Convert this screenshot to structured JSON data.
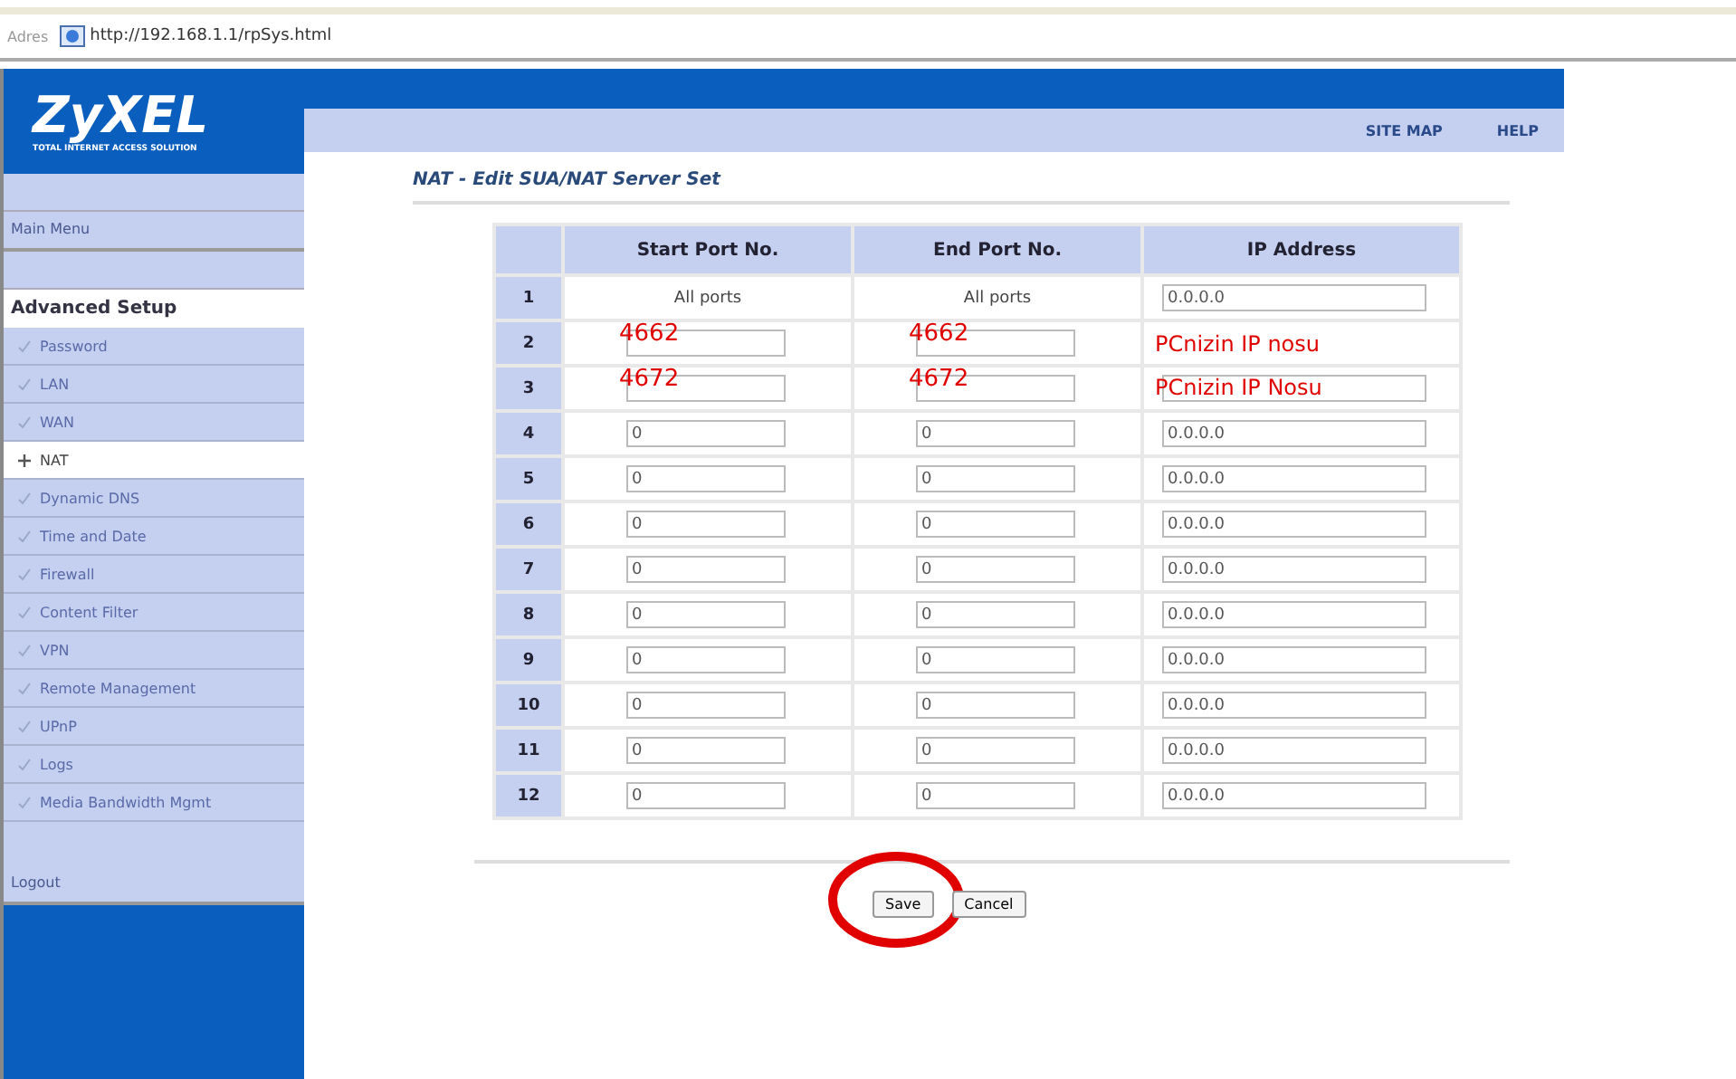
{
  "browser": {
    "address_label": "Adres",
    "url": "http://192.168.1.1/rpSys.html"
  },
  "logo": {
    "name": "ZyXEL",
    "tagline": "TOTAL INTERNET ACCESS SOLUTION"
  },
  "top_links": [
    "SITE MAP",
    "HELP"
  ],
  "sidebar": {
    "main_menu": "Main Menu",
    "section": "Advanced Setup",
    "items": [
      {
        "label": "Password",
        "selected": false
      },
      {
        "label": "LAN",
        "selected": false
      },
      {
        "label": "WAN",
        "selected": false
      },
      {
        "label": "NAT",
        "selected": true
      },
      {
        "label": "Dynamic DNS",
        "selected": false
      },
      {
        "label": "Time and Date",
        "selected": false
      },
      {
        "label": "Firewall",
        "selected": false
      },
      {
        "label": "Content Filter",
        "selected": false
      },
      {
        "label": "VPN",
        "selected": false
      },
      {
        "label": "Remote Management",
        "selected": false
      },
      {
        "label": "UPnP",
        "selected": false
      },
      {
        "label": "Logs",
        "selected": false
      },
      {
        "label": "Media Bandwidth Mgmt",
        "selected": false
      }
    ],
    "logout": "Logout"
  },
  "page_title": "NAT - Edit SUA/NAT Server Set",
  "table": {
    "columns": [
      "Start Port No.",
      "End Port No.",
      "IP Address"
    ],
    "rows": [
      {
        "number": "1",
        "cells": [
          {
            "kind": "text",
            "value": "All ports"
          },
          {
            "kind": "text",
            "value": "All ports"
          },
          {
            "kind": "input",
            "value": "0.0.0.0"
          }
        ]
      },
      {
        "number": "2",
        "cells": [
          {
            "kind": "annotated",
            "annotation": "4662"
          },
          {
            "kind": "annotated",
            "annotation": "4662"
          },
          {
            "kind": "note",
            "annotation": "PCnizin IP nosu"
          }
        ]
      },
      {
        "number": "3",
        "cells": [
          {
            "kind": "annotated",
            "annotation": "4672"
          },
          {
            "kind": "annotated",
            "annotation": "4672"
          },
          {
            "kind": "annotated",
            "annotation": "PCnizin IP Nosu"
          }
        ]
      },
      {
        "number": "4",
        "cells": [
          {
            "kind": "input",
            "value": "0"
          },
          {
            "kind": "input",
            "value": "0"
          },
          {
            "kind": "input",
            "value": "0.0.0.0"
          }
        ]
      },
      {
        "number": "5",
        "cells": [
          {
            "kind": "input",
            "value": "0"
          },
          {
            "kind": "input",
            "value": "0"
          },
          {
            "kind": "input",
            "value": "0.0.0.0"
          }
        ]
      },
      {
        "number": "6",
        "cells": [
          {
            "kind": "input",
            "value": "0"
          },
          {
            "kind": "input",
            "value": "0"
          },
          {
            "kind": "input",
            "value": "0.0.0.0"
          }
        ]
      },
      {
        "number": "7",
        "cells": [
          {
            "kind": "input",
            "value": "0"
          },
          {
            "kind": "input",
            "value": "0"
          },
          {
            "kind": "input",
            "value": "0.0.0.0"
          }
        ]
      },
      {
        "number": "8",
        "cells": [
          {
            "kind": "input",
            "value": "0"
          },
          {
            "kind": "input",
            "value": "0"
          },
          {
            "kind": "input",
            "value": "0.0.0.0"
          }
        ]
      },
      {
        "number": "9",
        "cells": [
          {
            "kind": "input",
            "value": "0"
          },
          {
            "kind": "input",
            "value": "0"
          },
          {
            "kind": "input",
            "value": "0.0.0.0"
          }
        ]
      },
      {
        "number": "10",
        "cells": [
          {
            "kind": "input",
            "value": "0"
          },
          {
            "kind": "input",
            "value": "0"
          },
          {
            "kind": "input",
            "value": "0.0.0.0"
          }
        ]
      },
      {
        "number": "11",
        "cells": [
          {
            "kind": "input",
            "value": "0"
          },
          {
            "kind": "input",
            "value": "0"
          },
          {
            "kind": "input",
            "value": "0.0.0.0"
          }
        ]
      },
      {
        "number": "12",
        "cells": [
          {
            "kind": "input",
            "value": "0"
          },
          {
            "kind": "input",
            "value": "0"
          },
          {
            "kind": "input",
            "value": "0.0.0.0"
          }
        ]
      }
    ]
  },
  "buttons": [
    {
      "label": "Save",
      "circled": true
    },
    {
      "label": "Cancel",
      "circled": false
    }
  ]
}
